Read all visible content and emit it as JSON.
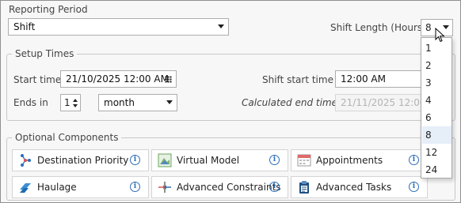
{
  "reporting_period": {
    "label": "Reporting Period",
    "value": "Shift"
  },
  "shift_length": {
    "label": "Shift Length (Hours)",
    "value": "8",
    "options": [
      "1",
      "2",
      "3",
      "4",
      "6",
      "8",
      "12",
      "24"
    ],
    "highlighted": "8"
  },
  "setup_times": {
    "legend": "Setup Times",
    "start_time_label": "Start time",
    "start_time_value": "21/10/2025 12:00 AM",
    "ends_in_label": "Ends in",
    "ends_in_value": "1",
    "ends_in_unit": "month",
    "shift_start_label": "Shift start time",
    "shift_start_value": "12:00 AM",
    "calculated_end_label": "Calculated end time",
    "calculated_end_value": "21/11/2025 12:00 AM"
  },
  "optional_components": {
    "legend": "Optional Components",
    "items": [
      {
        "label": "Destination Priority",
        "icon": "destination-priority-icon"
      },
      {
        "label": "Virtual Model",
        "icon": "virtual-model-icon"
      },
      {
        "label": "Appointments",
        "icon": "calendar-icon"
      },
      {
        "label": "Haulage",
        "icon": "haulage-icon"
      },
      {
        "label": "Advanced Constraints",
        "icon": "constraints-icon"
      },
      {
        "label": "Advanced Tasks",
        "icon": "clipboard-icon"
      }
    ],
    "info_glyph": "i"
  },
  "colors": {
    "accent": "#2d6fb7",
    "border": "#adadad",
    "background": "#f7f7f7"
  }
}
